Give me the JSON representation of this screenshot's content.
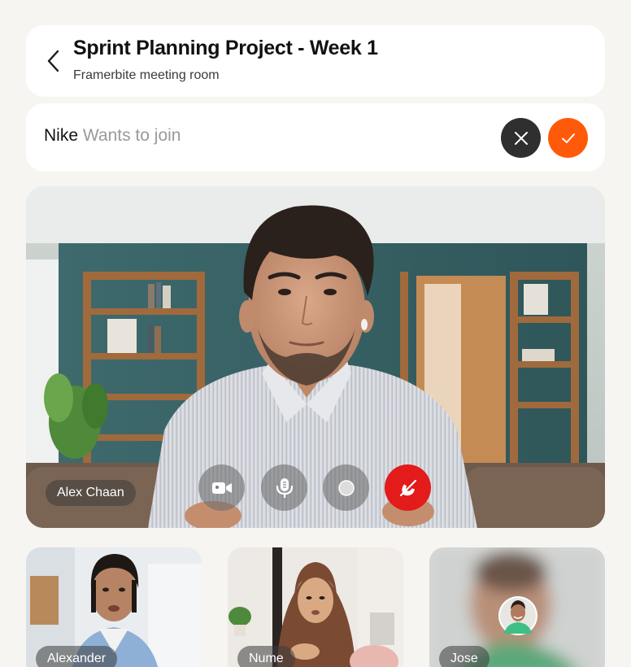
{
  "header": {
    "title": "Sprint Planning Project - Week 1",
    "subtitle": "Framerbite meeting room"
  },
  "join_request": {
    "name": "Nike",
    "message": "Wants to join"
  },
  "main_participant": {
    "name": "Alex Chaan"
  },
  "controls": [
    "camera-icon",
    "microphone-icon",
    "record-icon",
    "end-call-icon"
  ],
  "participants": [
    {
      "name": "Alexander"
    },
    {
      "name": "Nume"
    },
    {
      "name": "Jose"
    }
  ],
  "colors": {
    "accent": "#ff5a0a",
    "decline": "#2f2f2f",
    "end_call": "#e31b1b",
    "background": "#f6f5f1"
  }
}
